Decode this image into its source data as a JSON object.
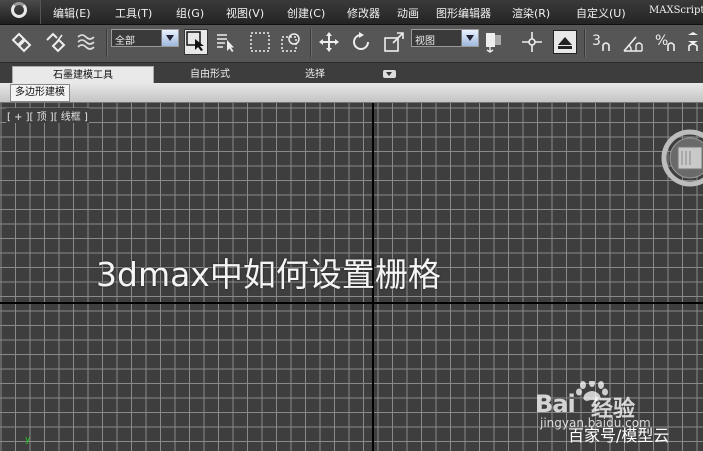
{
  "menu": {
    "items": [
      "编辑(E)",
      "工具(T)",
      "组(G)",
      "视图(V)",
      "创建(C)",
      "修改器",
      "动画",
      "图形编辑器",
      "渲染(R)",
      "自定义(U)",
      "MAXScript"
    ]
  },
  "toolbar": {
    "selection_filter": "全部",
    "reference_coord": "视图"
  },
  "ribbon": {
    "tabs": [
      "石墨建模工具",
      "自由形式",
      "选择"
    ],
    "active_tab": "石墨建模工具",
    "sub_button": "多边形建模"
  },
  "viewport": {
    "label": "[ + ][ 顶 ][ 线框 ]",
    "overlay_title": "3dmax中如何设置栅格",
    "axis_indicator": "y"
  },
  "watermark": {
    "brand": "Bai",
    "brand_suffix": "经验",
    "url": "jingyan.baidu.com",
    "author": "百家号/模型云"
  },
  "colors": {
    "grid_line": "#8a8a8a",
    "viewport_bg": "#3e3e3e",
    "axis": "#000000",
    "toolbar_bg": "#565656",
    "dropdown_arrow": "#9fb8dc"
  }
}
